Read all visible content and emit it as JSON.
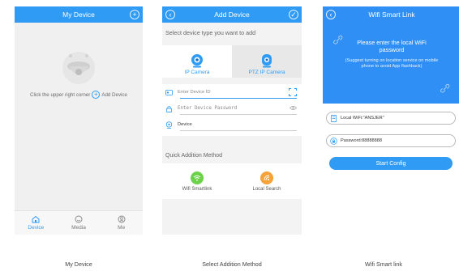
{
  "screens": {
    "my_device": {
      "title": "My Device",
      "hint_before": "Click the upper right corner",
      "hint_after": "Add Device",
      "tabs": [
        {
          "label": "Device",
          "icon": "home-icon",
          "active": true
        },
        {
          "label": "Media",
          "icon": "smiley-icon",
          "active": false
        },
        {
          "label": "Me",
          "icon": "person-icon",
          "active": false
        }
      ]
    },
    "add_device": {
      "title": "Add Device",
      "type_prompt": "Select device type you want to add",
      "types": [
        {
          "label": "IP Camera",
          "icon": "ip-camera-icon",
          "active": true
        },
        {
          "label": "PTZ IP Camera",
          "icon": "ptz-camera-icon",
          "active": false
        }
      ],
      "fields": {
        "device_id_placeholder": "Enter Device ID",
        "password_placeholder": "Enter Device Password",
        "device_name_value": "Device"
      },
      "quick_title": "Quick Addition Method",
      "methods": [
        {
          "label": "Wifi Smartlink",
          "icon": "wifi-icon",
          "color": "#6cd24a"
        },
        {
          "label": "Local Search",
          "icon": "radar-search-icon",
          "color": "#f5a23a"
        }
      ]
    },
    "wifi_smart_link": {
      "title": "Wifi Smart Link",
      "banner_main": "Please enter the local WiFi password",
      "banner_sub": "(Suggest turning on location service on mobile phone to avoid App flashback)",
      "local_wifi": "Local WiFi:\"ANSJER\"",
      "password": "Password:88888888",
      "start_label": "Start Config"
    }
  },
  "captions": [
    "My Device",
    "Select Addition Method",
    "Wifi Smart link"
  ],
  "colors": {
    "primary": "#2f9bf5",
    "banner": "#2f8ff5",
    "green": "#6cd24a",
    "orange": "#f5a23a"
  }
}
